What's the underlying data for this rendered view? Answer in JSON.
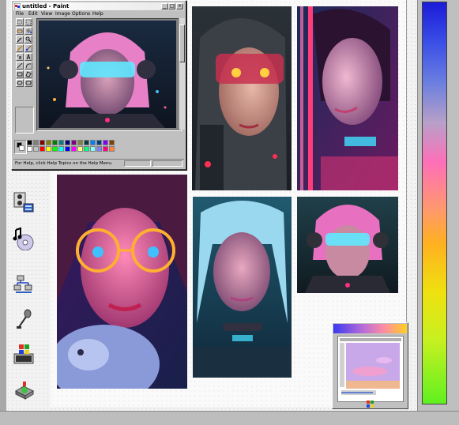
{
  "window": {
    "title": "untitled - Paint",
    "minimize_symbol": "_",
    "maximize_symbol": "□",
    "close_symbol": "×"
  },
  "menu": {
    "items": [
      "File",
      "Edit",
      "View",
      "Image",
      "Options",
      "Help"
    ]
  },
  "status_bar": {
    "text": "For Help, click Help Topics on the Help Menu."
  },
  "toolbox": {
    "tools": [
      "free-select-icon",
      "rect-select-icon",
      "eraser-icon",
      "fill-bucket-icon",
      "color-picker-icon",
      "magnifier-icon",
      "pencil-icon",
      "brush-icon",
      "airbrush-icon",
      "text-icon",
      "line-icon",
      "curve-icon",
      "rectangle-icon",
      "polygon-icon",
      "ellipse-icon",
      "rounded-rect-icon"
    ]
  },
  "palette": {
    "foreground": "#000000",
    "background": "#ffffff",
    "colors_top": [
      "#000000",
      "#808080",
      "#800000",
      "#808000",
      "#008000",
      "#008080",
      "#000080",
      "#800080",
      "#808040",
      "#004040",
      "#0080ff",
      "#004080",
      "#8000ff",
      "#804000"
    ],
    "colors_bottom": [
      "#ffffff",
      "#c0c0c0",
      "#ff0000",
      "#ffff00",
      "#00ff00",
      "#00ffff",
      "#0000ff",
      "#ff00ff",
      "#ffff80",
      "#00ff80",
      "#80ffff",
      "#8080ff",
      "#ff0080",
      "#ff8040"
    ]
  },
  "desktop_icons": [
    {
      "name": "media-player-icon"
    },
    {
      "name": "cd-player-icon"
    },
    {
      "name": "network-icon"
    },
    {
      "name": "microphone-icon"
    },
    {
      "name": "windows-media-icon"
    },
    {
      "name": "disk-tool-icon"
    }
  ],
  "colors": {
    "desktop": "#c0c0c0",
    "title_gradient_start": "#ffffff",
    "spectrum_top": "#1b1bd8",
    "spectrum_bottom": "#60f020"
  },
  "artworks": [
    {
      "name": "artwork-paint-visor-girl"
    },
    {
      "name": "artwork-hooded-red-eyes"
    },
    {
      "name": "artwork-pink-neon-profile"
    },
    {
      "name": "artwork-neon-glasses-girl"
    },
    {
      "name": "artwork-blue-hair-choker"
    },
    {
      "name": "artwork-visor-girl-small"
    }
  ]
}
